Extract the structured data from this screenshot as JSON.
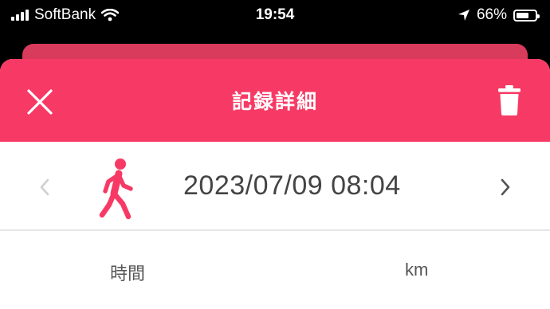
{
  "status_bar": {
    "carrier": "SoftBank",
    "time": "19:54",
    "battery": "66%",
    "battery_level": 0.66,
    "icons": [
      "signal-icon",
      "wifi-icon",
      "location-arrow-icon",
      "battery-icon"
    ]
  },
  "header": {
    "title": "記録詳細",
    "background_color": "#f73a65",
    "close_icon": "close-icon",
    "delete_icon": "trash-icon"
  },
  "record": {
    "datetime": "2023/07/09 08:04",
    "activity_icon": "walking-person-icon",
    "accent_color": "#f73a65"
  },
  "stats": {
    "time_label": "時間",
    "distance_label": "km"
  }
}
